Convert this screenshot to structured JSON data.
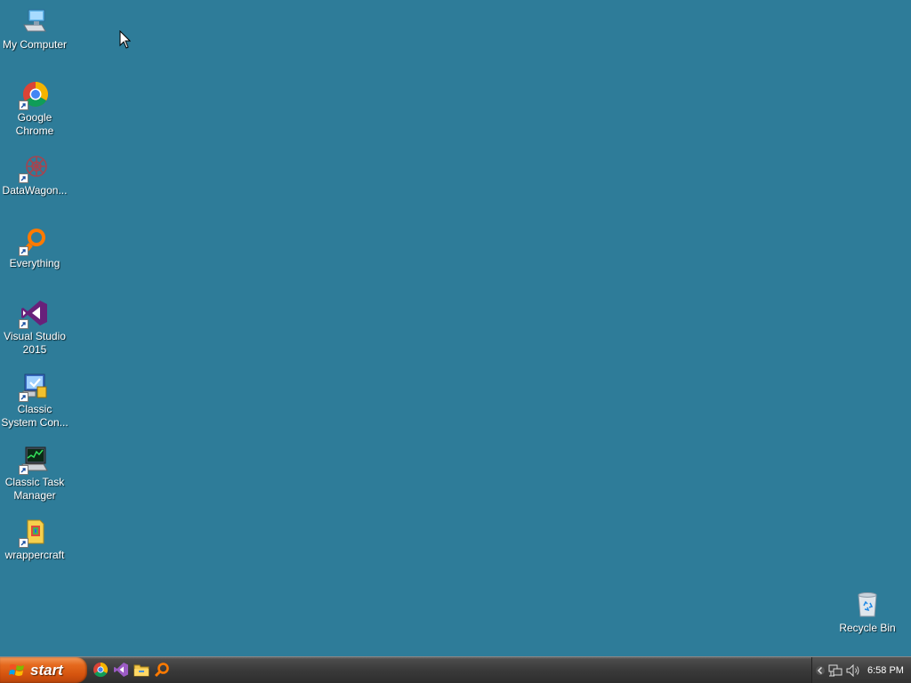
{
  "desktop": {
    "background_color": "#2e7c99",
    "icons": [
      {
        "label": "My Computer",
        "icon": "computer-icon"
      },
      {
        "label": "Google Chrome",
        "icon": "chrome-icon"
      },
      {
        "label": "DataWagon...",
        "icon": "datawagon-icon"
      },
      {
        "label": "Everything",
        "icon": "everything-search-icon"
      },
      {
        "label": "Visual Studio 2015",
        "icon": "visual-studio-icon"
      },
      {
        "label": "Classic System Con...",
        "icon": "control-panel-icon"
      },
      {
        "label": "Classic Task Manager",
        "icon": "task-manager-icon"
      },
      {
        "label": "wrappercraft",
        "icon": "wrappercraft-icon"
      }
    ],
    "recycle_bin": {
      "label": "Recycle Bin",
      "icon": "recycle-bin-icon"
    }
  },
  "taskbar": {
    "start_label": "start",
    "quick_launch": [
      "chrome-icon",
      "visual-studio-icon",
      "file-explorer-icon",
      "everything-search-icon"
    ],
    "tray": {
      "icons": [
        "chevron-left-icon",
        "network-icon",
        "volume-icon"
      ],
      "clock": "6:58 PM"
    }
  }
}
